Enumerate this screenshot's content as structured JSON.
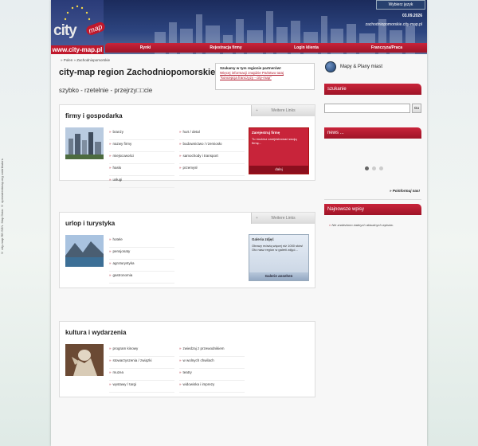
{
  "side_credit": "© city-map RE.SEN. Map Data: © openstreetmap.org contributors",
  "header": {
    "logo_city": "city",
    "logo_map": "map",
    "logo_url": "www.city-map.pl",
    "language_button": "Wybierz język",
    "date": "03.09.2026",
    "domain": "zachodniopomorskie.city-map.pl"
  },
  "nav": {
    "items": [
      "Rynki",
      "Rejestracja firmy",
      "Login klienta",
      "Franczyza/Praca"
    ]
  },
  "breadcrumb": "» Polen » Zachodniopomorskie",
  "page": {
    "title": "city-map region Zachodniopomorskie",
    "subtitle": "szybko - rzetelnie - przejrzy□□cie"
  },
  "partner_box": {
    "heading": "Szukamy w tym regionie partnerów!",
    "line1": "Więcej informacji znajdzie Państwo tutaj",
    "line2": "\"koncepcja franczyzy - city-map\""
  },
  "sections": [
    {
      "title": "firmy i gospodarka",
      "tab": "Weitere Links",
      "links_col1": [
        "branży",
        "nazwy firmy",
        "miejscowości",
        "hasło",
        "usługi"
      ],
      "links_col2": [
        "hurt / detal",
        "budownictwo / rzemiosło",
        "samochody i transport",
        "przemysł"
      ],
      "promo": {
        "title": "Zarejestruj firmę",
        "desc": "Tu możesz zarejestrować swoją firmę...",
        "button": "dalej"
      }
    },
    {
      "title": "urlop i turystyka",
      "tab": "Weitere Links",
      "links_col1": [
        "hotele",
        "pensjonaty",
        "agroturystyka",
        "gastronomia"
      ],
      "links_col2": [],
      "promo": {
        "title": "Galeria zdjęć",
        "desc": "Obrazy mówią więcej niż 1000 słów! Oto nasz region w galerii zdjęć...",
        "button": "Galerie ansehen"
      }
    },
    {
      "title": "kultura i wydarzenia",
      "tab": "",
      "links_col1": [
        "program kinowy",
        "stowarzyszenia / związki",
        "muzea",
        "wystawy / targi"
      ],
      "links_col2": [
        "zwiedzaj z przewodnikiem",
        "w wolnych chwilach",
        "teatry",
        "widowiska i imprezy"
      ],
      "promo": null
    }
  ],
  "sidebar": {
    "maps_label": "Mapy & Plany miast",
    "search_header": "szukanie",
    "search_value": "",
    "search_button": "Go",
    "news_header": "news ...",
    "feedback_link": "» Poinformuj nas!",
    "latest_header": "Najnowsze wpisy",
    "latest_note": "Nie znaleziono żadnych aktualnych wpisów."
  },
  "colors": {
    "brand_red": "#c8243a",
    "header_blue": "#1b2b5c"
  }
}
